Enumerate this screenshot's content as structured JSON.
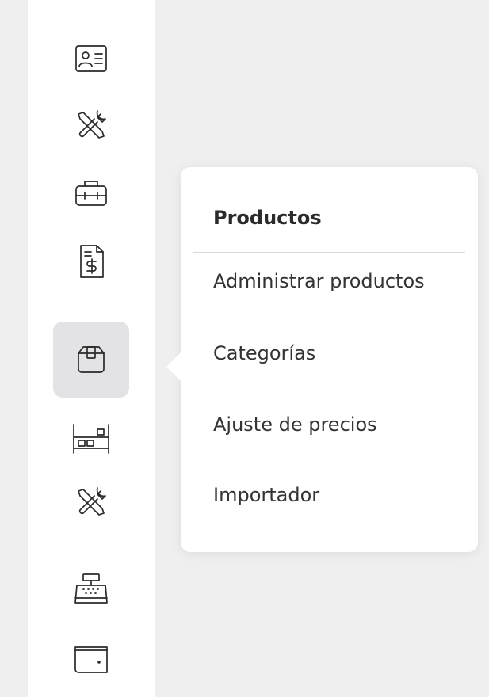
{
  "sidebar": {
    "items": [
      {
        "icon": "contact-card-icon"
      },
      {
        "icon": "tools-icon"
      },
      {
        "icon": "toolbox-icon"
      },
      {
        "icon": "invoice-dollar-icon"
      },
      {
        "icon": "product-box-icon",
        "active": true
      },
      {
        "icon": "warehouse-shelf-icon"
      },
      {
        "icon": "tools-icon"
      },
      {
        "icon": "cash-register-icon"
      },
      {
        "icon": "wallet-icon"
      }
    ]
  },
  "popover": {
    "title": "Productos",
    "items": [
      {
        "label": "Administrar productos"
      },
      {
        "label": "Categorías"
      },
      {
        "label": "Ajuste de precios"
      },
      {
        "label": "Importador"
      }
    ]
  },
  "colors": {
    "background": "#efefef",
    "sidebar": "#ffffff",
    "active_item": "#e3e3e5",
    "text": "#333333"
  }
}
